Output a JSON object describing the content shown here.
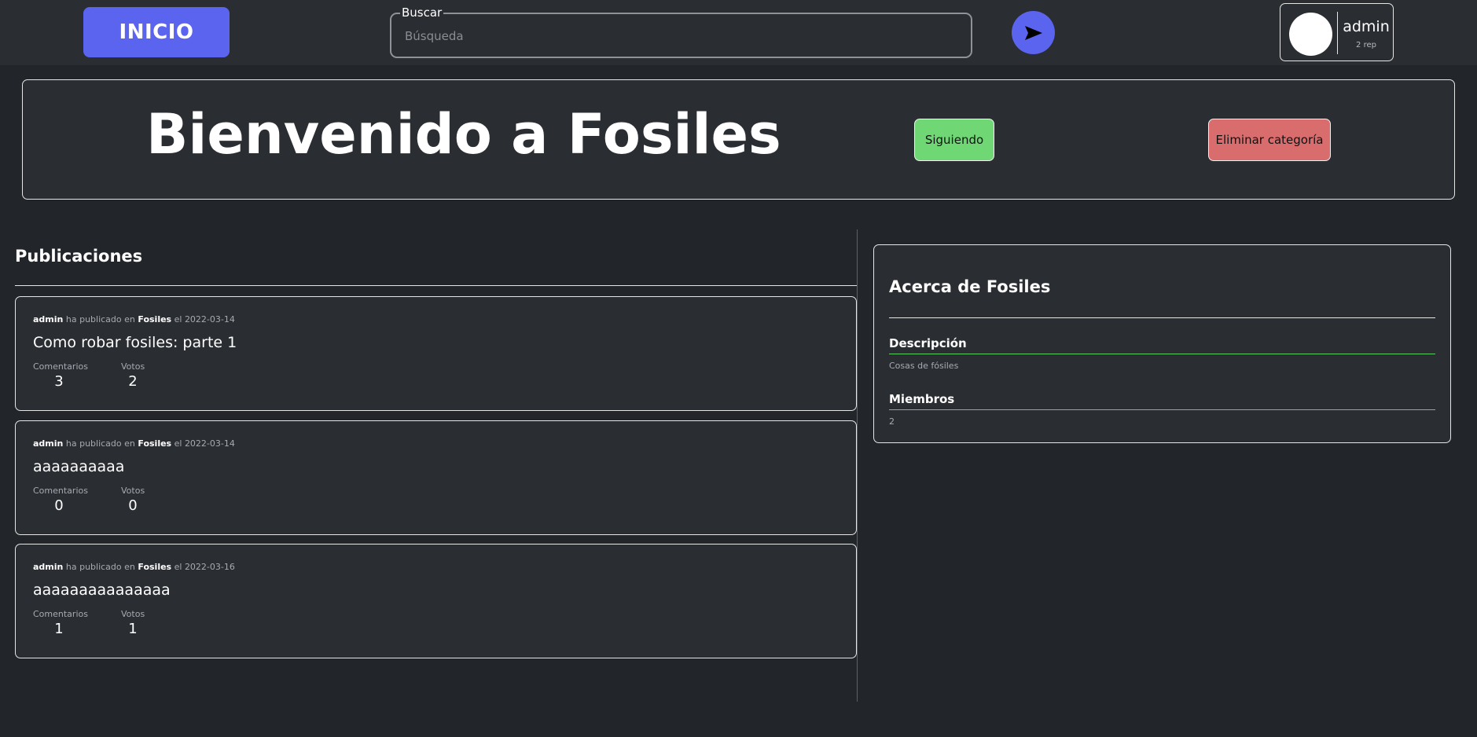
{
  "header": {
    "home_label": "INICIO",
    "search_legend": "Buscar",
    "search_placeholder": "Búsqueda",
    "search_value": "",
    "send_icon": "send-arrow-icon",
    "user": {
      "name": "admin",
      "rep": "2 rep",
      "avatar_icon": "avatar"
    }
  },
  "banner": {
    "title": "Bienvenido a Fosiles",
    "follow_label": "Siguiendo",
    "delete_label": "Eliminar categoría"
  },
  "posts": {
    "heading": "Publicaciones",
    "comments_label": "Comentarios",
    "votes_label": "Votos",
    "published_text": "ha publicado en",
    "on_text": "el",
    "items": [
      {
        "author": "admin",
        "category": "Fosiles",
        "date": "2022-03-14",
        "title": "Como robar fosiles: parte 1",
        "comments": "3",
        "votes": "2"
      },
      {
        "author": "admin",
        "category": "Fosiles",
        "date": "2022-03-14",
        "title": "aaaaaaaaaa",
        "comments": "0",
        "votes": "0"
      },
      {
        "author": "admin",
        "category": "Fosiles",
        "date": "2022-03-16",
        "title": "aaaaaaaaaaaaaaa",
        "comments": "1",
        "votes": "1"
      }
    ]
  },
  "about": {
    "title": "Acerca de Fosiles",
    "description_label": "Descripción",
    "description_value": "Cosas de fósiles",
    "members_label": "Miembros",
    "members_value": "2"
  },
  "colors": {
    "accent": "#5b64ef",
    "follow": "#6fd874",
    "delete": "#d96d6d",
    "background": "#222529",
    "panel": "#2a2d32"
  }
}
